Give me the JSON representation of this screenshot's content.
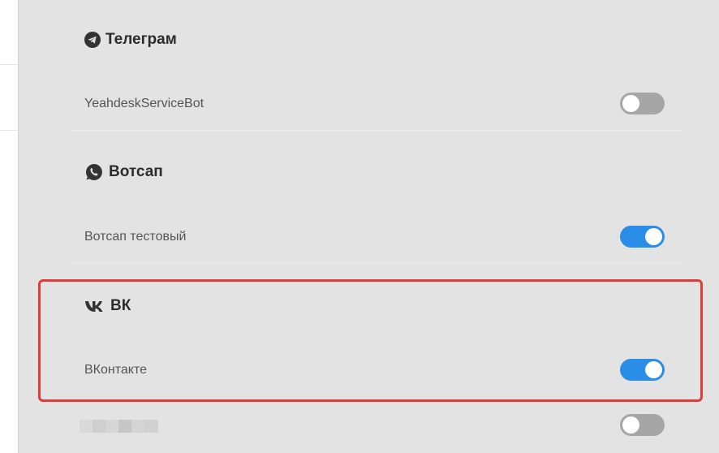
{
  "sections": [
    {
      "title": "Телеграм",
      "icon": "telegram-icon",
      "item": {
        "label": "YeahdeskServiceBot",
        "enabled": false
      }
    },
    {
      "title": "Вотсап",
      "icon": "whatsapp-icon",
      "item": {
        "label": "Вотсап тестовый",
        "enabled": true
      }
    },
    {
      "title": "ВК",
      "icon": "vk-icon",
      "item": {
        "label": "ВКонтакте",
        "enabled": true
      },
      "highlighted": true
    }
  ],
  "trailing_item": {
    "label_redacted": true,
    "enabled": false
  },
  "colors": {
    "toggle_on": "#2a8de8",
    "toggle_off": "#a6a6a6",
    "highlight": "#e03b36",
    "panel_bg": "#e3e3e3"
  }
}
